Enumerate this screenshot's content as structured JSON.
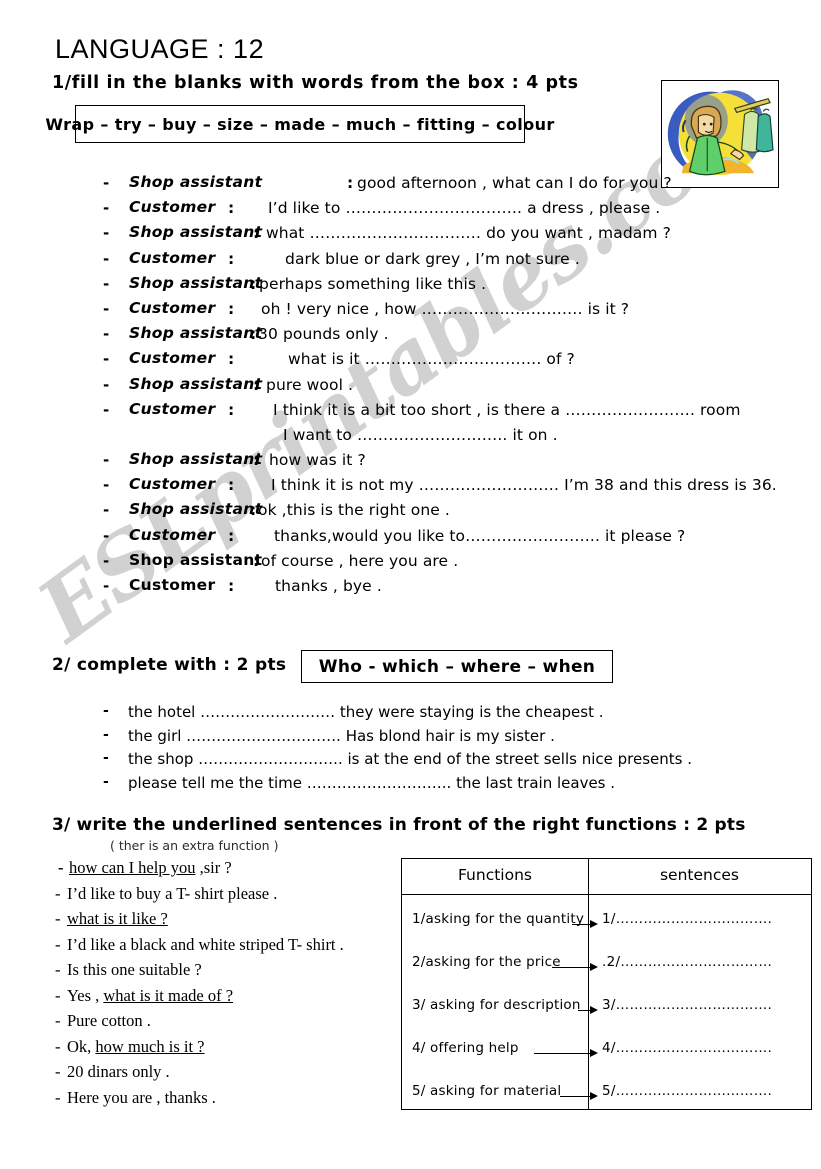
{
  "title": "LANGUAGE : 12",
  "task1": {
    "heading": "1/fill in the blanks with words from the box : 4 pts",
    "wordbox": "Wrap – try – buy – size – made – much – fitting – colour",
    "illustration_name": "shopping-clipart",
    "dialogue": [
      {
        "dash": "-",
        "speaker": "Shop assistant",
        "colon": ":",
        "text": "good afternoon , what can I do for you ?"
      },
      {
        "dash": "-",
        "speaker": "Customer",
        "colon": ":",
        "text": "I’d like to ……………………………. a dress , please ."
      },
      {
        "dash": "-",
        "speaker": "Shop assistant",
        "colon": ":",
        "text": "what …………………………… do you want , madam ?"
      },
      {
        "dash": "-",
        "speaker": "Customer",
        "colon": ":",
        "text": "dark blue or dark grey , I’m not sure ."
      },
      {
        "dash": "-",
        "speaker": "Shop assistant",
        "colon": ":",
        "text": "perhaps something like this ."
      },
      {
        "dash": "-",
        "speaker": "Customer",
        "colon": ":",
        "text": "oh ! very nice , how …………………………. is it ?"
      },
      {
        "dash": "-",
        "speaker": "Shop assistant",
        "colon": ":",
        "text": "30 pounds only ."
      },
      {
        "dash": "-",
        "speaker": "Customer",
        "colon": ":",
        "text": "what is it ……………………………. of ?"
      },
      {
        "dash": "-",
        "speaker": "Shop assistant",
        "colon": ":",
        "text": "pure wool ."
      },
      {
        "dash": "-",
        "speaker": "Customer",
        "colon": ":",
        "text": "I think it is a bit too short , is there a ……………………. room"
      },
      {
        "dash": "",
        "speaker": "",
        "colon": "",
        "text": "I want to ……………………….. it  on ."
      },
      {
        "dash": "-",
        "speaker": "Shop assistant",
        "colon": ":",
        "text": "how was it ?"
      },
      {
        "dash": "-",
        "speaker": "Customer",
        "colon": ":",
        "text": "I think it is not my ……………………… I’m 38 and this dress is 36."
      },
      {
        "dash": "-",
        "speaker": "Shop assistant",
        "colon": ":",
        "text": "ok ,this is the right one ."
      },
      {
        "dash": "-",
        "speaker": "Customer",
        "colon": ":",
        "text": "thanks,would you like to…………………….. it please ?"
      },
      {
        "dash": "-",
        "speaker": "Shop assistant",
        "colon": ":",
        "text": "of course , here you are ."
      },
      {
        "dash": "-",
        "speaker": "Customer",
        "colon": ":",
        "text": "thanks , bye  ."
      }
    ]
  },
  "task2": {
    "heading": "2/ complete with : 2 pts",
    "wordbox": "Who  - which – where – when",
    "items": [
      "the hotel ……………………… they were staying is the cheapest .",
      "the girl …………………………. Has blond hair is my sister .",
      "the shop ……………………….. is at the end of the street sells nice presents .",
      "please tell me the time ……………………….. the last train leaves ."
    ]
  },
  "task3": {
    "heading": "3/ write the underlined sentences in front of the right functions : 2 pts",
    "note": "( ther is an extra function )",
    "sentences": [
      {
        "dash": "-",
        "pre": "",
        "underlined": "how can I help you",
        "post": " ,sir ?"
      },
      {
        "dash": "-",
        "pre": " I’d like to buy a T- shirt please .",
        "underlined": "",
        "post": ""
      },
      {
        "dash": "-",
        "pre": "  ",
        "underlined": "what is it like ?",
        "post": ""
      },
      {
        "dash": "-",
        "pre": " I’d like a black and white striped T- shirt .",
        "underlined": "",
        "post": ""
      },
      {
        "dash": "-",
        "pre": " Is this one suitable ?",
        "underlined": "",
        "post": ""
      },
      {
        "dash": "-",
        "pre": " Yes , ",
        "underlined": "what is it made of ?",
        "post": ""
      },
      {
        "dash": "-",
        "pre": " Pure cotton .",
        "underlined": "",
        "post": ""
      },
      {
        "dash": "-",
        "pre": " Ok, ",
        "underlined": "how much is it ?",
        "post": ""
      },
      {
        "dash": "-",
        "pre": " 20 dinars only .",
        "underlined": "",
        "post": ""
      },
      {
        "dash": "-",
        "pre": " Here you are , thanks .",
        "underlined": "",
        "post": ""
      }
    ],
    "table": {
      "headers": [
        "Functions",
        "sentences"
      ],
      "rows": [
        {
          "function": "1/asking for the  quantity",
          "answer": "1/……………………………."
        },
        {
          "function": "2/asking for the  price",
          "answer": ".2/……………………………"
        },
        {
          "function": "3/ asking for description",
          "answer": "3/……………………………."
        },
        {
          "function": "4/ offering help",
          "answer": "4/……………………………."
        },
        {
          "function": "5/ asking for material",
          "answer": "5/……………………………."
        }
      ]
    }
  },
  "watermark": "ESLprintables.com"
}
